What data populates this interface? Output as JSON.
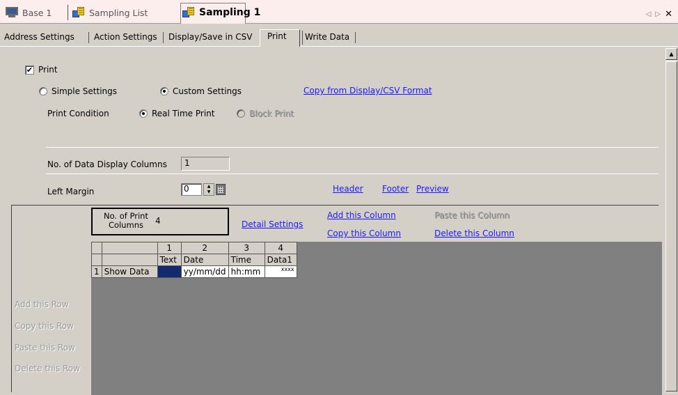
{
  "document_tabs": [
    {
      "label": "Base 1",
      "icon": "monitor-icon"
    },
    {
      "label": "Sampling List",
      "icon": "sampling-icon"
    },
    {
      "label": "Sampling 1",
      "icon": "sampling-icon",
      "active": true
    }
  ],
  "nav": {
    "prev": "◁",
    "next": "▷",
    "close": "✕"
  },
  "settings_tabs": [
    "Address Settings",
    "Action Settings",
    "Display/Save in CSV",
    "Print",
    "Write Data"
  ],
  "settings_active_tab": "Print",
  "print": {
    "checkbox_label": "Print",
    "checked": true,
    "simple_label": "Simple Settings",
    "custom_label": "Custom Settings",
    "mode_selected": "Custom Settings",
    "copy_link": "Copy from Display/CSV Format",
    "condition_label": "Print Condition",
    "realtime_label": "Real Time Print",
    "block_label": "Block Print",
    "condition_selected": "Real Time Print",
    "columns_label": "No. of Data Display Columns",
    "columns_value": "1",
    "margin_label": "Left Margin",
    "margin_value": "0",
    "header_link": "Header",
    "footer_link": "Footer",
    "preview_link": "Preview"
  },
  "grid": {
    "print_columns_label_line1": "No. of Print",
    "print_columns_label_line2": "Columns",
    "print_columns_value": "4",
    "detail_link": "Detail Settings",
    "add_col": "Add this Column",
    "copy_col": "Copy this Column",
    "paste_col": "Paste this Column",
    "delete_col": "Delete this Column",
    "add_row": "Add this Row",
    "copy_row": "Copy this Row",
    "paste_row": "Paste this Row",
    "delete_row": "Delete this Row",
    "column_numbers": [
      "1",
      "2",
      "3",
      "4"
    ],
    "column_types": [
      "Text",
      "Date",
      "Time",
      "Data1"
    ],
    "rows": [
      {
        "num": "1",
        "name": "Show Data",
        "cells": [
          "",
          "yy/mm/dd",
          "hh:mm",
          "xxxx"
        ]
      }
    ]
  }
}
